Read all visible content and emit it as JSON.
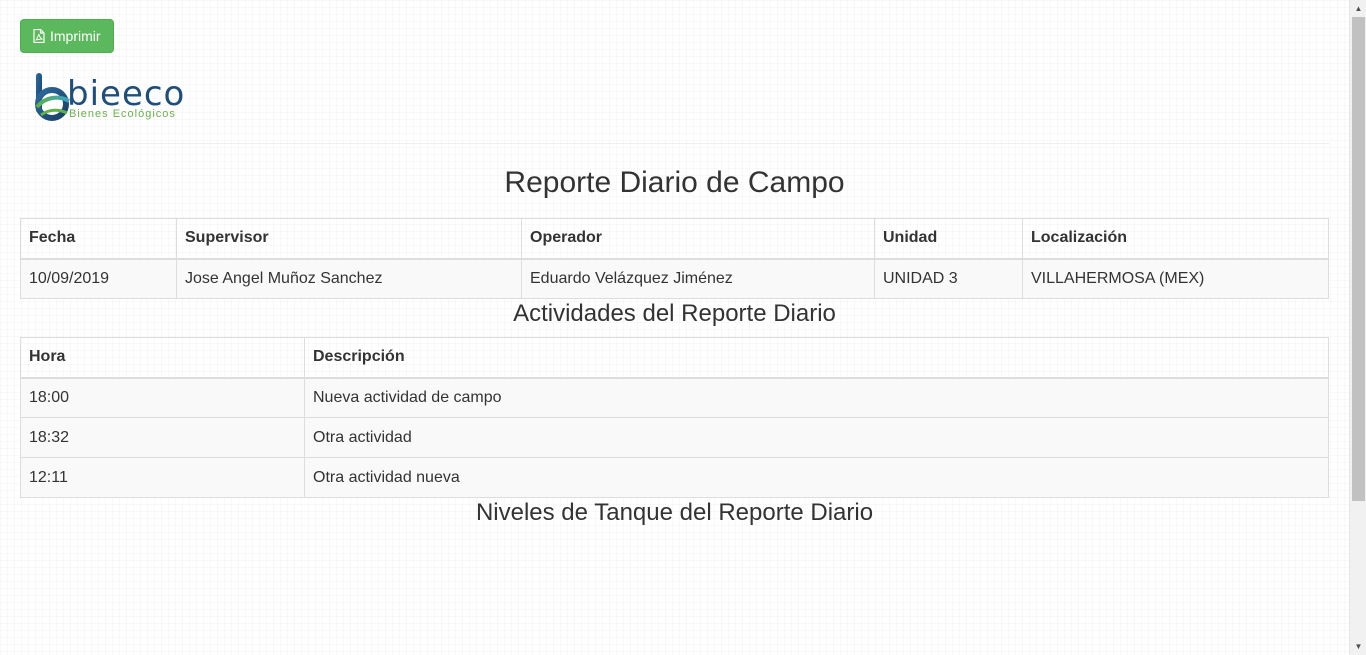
{
  "toolbar": {
    "print_label": "Imprimir",
    "print_icon": "file-pdf-icon",
    "print_color": "#5cb85c"
  },
  "logo": {
    "word": "bieeco",
    "subtitle": "Bienes Ecológicos",
    "brand_blue": "#1f4e7a",
    "brand_green": "#6ab04c"
  },
  "report": {
    "title": "Reporte Diario de Campo",
    "headers": [
      "Fecha",
      "Supervisor",
      "Operador",
      "Unidad",
      "Localización"
    ],
    "row": {
      "fecha": "10/09/2019",
      "supervisor": "Jose Angel Muñoz Sanchez",
      "operador": "Eduardo Velázquez Jiménez",
      "unidad": "UNIDAD 3",
      "localizacion": "VILLAHERMOSA (MEX)"
    }
  },
  "activities": {
    "title": "Actividades del Reporte Diario",
    "headers": [
      "Hora",
      "Descripción"
    ],
    "rows": [
      {
        "hora": "18:00",
        "descripcion": "Nueva actividad de campo"
      },
      {
        "hora": "18:32",
        "descripcion": "Otra actividad"
      },
      {
        "hora": "12:11",
        "descripcion": "Otra actividad nueva"
      }
    ]
  },
  "tank_levels": {
    "title": "Niveles de Tanque del Reporte Diario"
  }
}
